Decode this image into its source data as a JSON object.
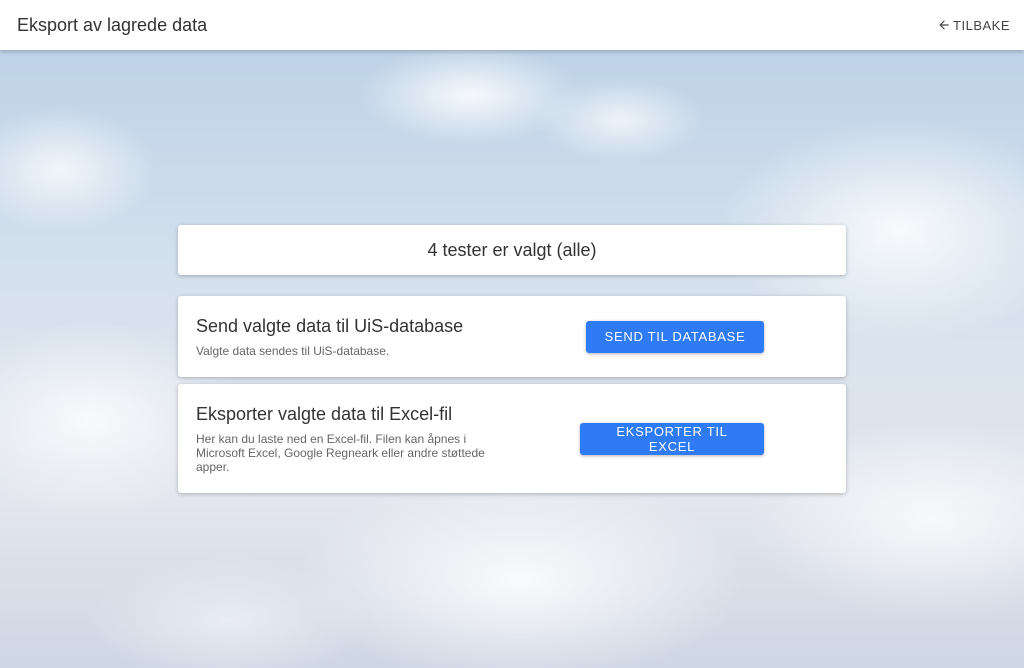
{
  "appbar": {
    "title": "Eksport av lagrede data",
    "back_label": "TILBAKE",
    "back_icon": "arrow-left-icon"
  },
  "selection": {
    "summary": "4 tester er valgt (alle)"
  },
  "database_card": {
    "title": "Send valgte data til UiS-database",
    "description": "Valgte data sendes til UiS-database.",
    "button_label": "SEND TIL DATABASE"
  },
  "excel_card": {
    "title": "Eksporter valgte data til Excel-fil",
    "description": "Her kan du laste ned en Excel-fil. Filen kan åpnes i Microsoft Excel, Google Regneark eller andre støttede apper.",
    "button_label": "EKSPORTER TIL EXCEL"
  },
  "colors": {
    "primary": "#2f7af5",
    "appbar_bg": "#ffffff",
    "text": "#333333"
  }
}
